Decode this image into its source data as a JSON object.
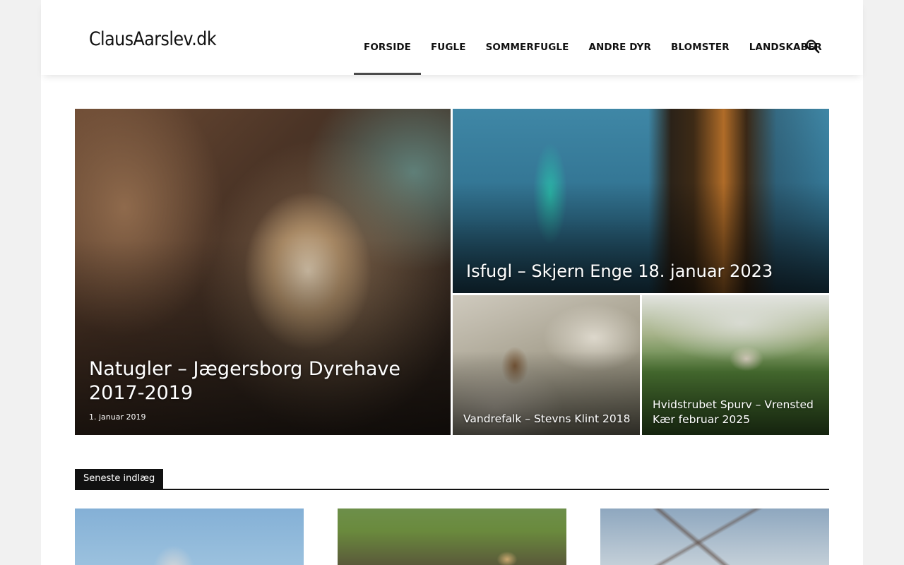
{
  "site": {
    "logo_text": "ClausAarslev.dk"
  },
  "nav": {
    "items": [
      {
        "label": "FORSIDE",
        "active": true
      },
      {
        "label": "FUGLE",
        "active": false
      },
      {
        "label": "SOMMERFUGLE",
        "active": false
      },
      {
        "label": "ANDRE DYR",
        "active": false
      },
      {
        "label": "BLOMSTER",
        "active": false
      },
      {
        "label": "LANDSKABER",
        "active": false
      }
    ],
    "search_icon": "search-icon"
  },
  "featured": {
    "big": {
      "title": "Natugler – Jægersborg Dyrehave 2017-2019",
      "date": "1. januar 2019"
    },
    "top_right": {
      "title": "Isfugl – Skjern Enge 18. januar 2023"
    },
    "bottom_left": {
      "title": "Vandrefalk – Stevns Klint 2018"
    },
    "bottom_right": {
      "title": "Hvidstrubet Spurv – Vrensted Kær februar 2025"
    }
  },
  "latest": {
    "heading": "Seneste indlæg"
  },
  "colors": {
    "accent": "#111111",
    "active_underline": "#4b4b4b",
    "background": "#f1f1f1"
  }
}
